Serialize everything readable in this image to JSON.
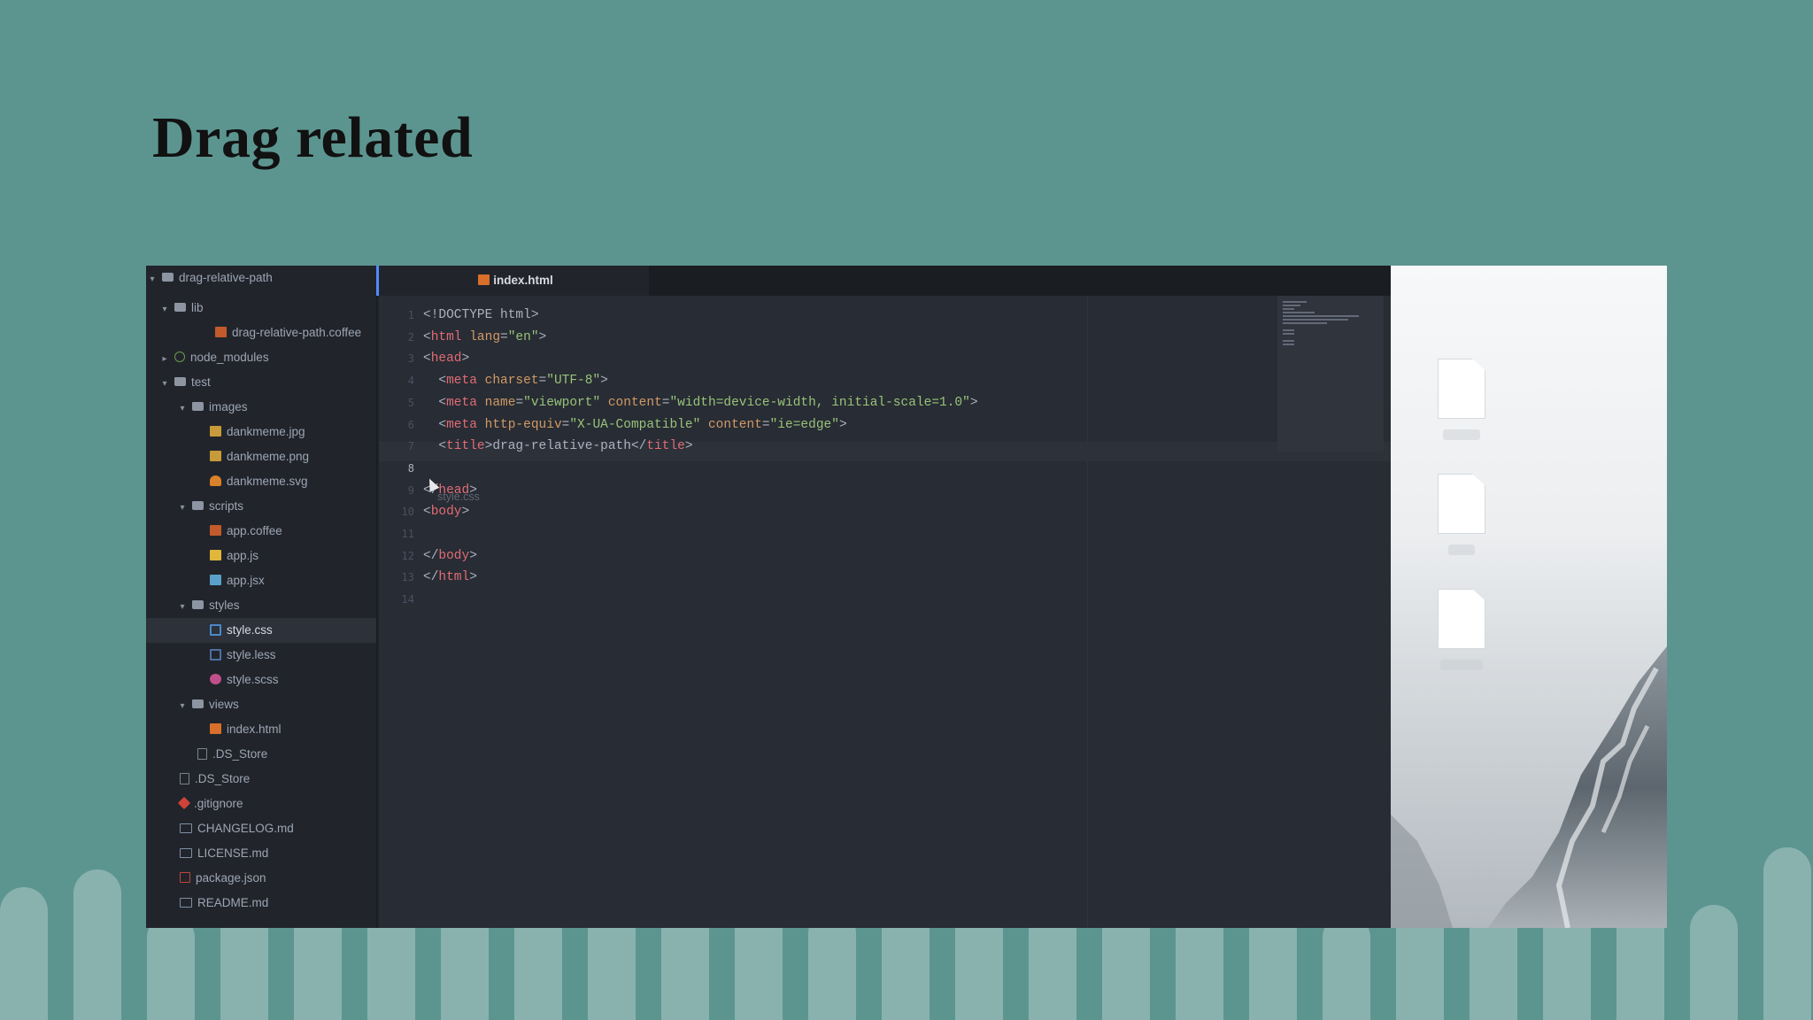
{
  "slide": {
    "title": "Drag related"
  },
  "tree": {
    "root": "drag-relative-path",
    "rows": [
      {
        "label": "lib",
        "arrow": "▾",
        "icon": "folder"
      },
      {
        "label": "drag-relative-path.coffee",
        "arrow": "",
        "icon": "coffee"
      },
      {
        "label": "node_modules",
        "arrow": "▸",
        "icon": "modules"
      },
      {
        "label": "test",
        "arrow": "▾",
        "icon": "folder"
      },
      {
        "label": "images",
        "arrow": "▾",
        "icon": "folder"
      },
      {
        "label": "dankmeme.jpg",
        "arrow": "",
        "icon": "img"
      },
      {
        "label": "dankmeme.png",
        "arrow": "",
        "icon": "img"
      },
      {
        "label": "dankmeme.svg",
        "arrow": "",
        "icon": "svgi"
      },
      {
        "label": "scripts",
        "arrow": "▾",
        "icon": "folder"
      },
      {
        "label": "app.coffee",
        "arrow": "",
        "icon": "coffee"
      },
      {
        "label": "app.js",
        "arrow": "",
        "icon": "js"
      },
      {
        "label": "app.jsx",
        "arrow": "",
        "icon": "jsx"
      },
      {
        "label": "styles",
        "arrow": "▾",
        "icon": "folder"
      },
      {
        "label": "style.css",
        "arrow": "",
        "icon": "css",
        "selected": true
      },
      {
        "label": "style.less",
        "arrow": "",
        "icon": "less"
      },
      {
        "label": "style.scss",
        "arrow": "",
        "icon": "scss"
      },
      {
        "label": "views",
        "arrow": "▾",
        "icon": "folder"
      },
      {
        "label": "index.html",
        "arrow": "",
        "icon": "html"
      },
      {
        "label": ".DS_Store",
        "arrow": "",
        "icon": "doc"
      },
      {
        "label": ".DS_Store",
        "arrow": "",
        "icon": "doc"
      },
      {
        "label": ".gitignore",
        "arrow": "",
        "icon": "git"
      },
      {
        "label": "CHANGELOG.md",
        "arrow": "",
        "icon": "md"
      },
      {
        "label": "LICENSE.md",
        "arrow": "",
        "icon": "md"
      },
      {
        "label": "package.json",
        "arrow": "",
        "icon": "json"
      },
      {
        "label": "README.md",
        "arrow": "",
        "icon": "md"
      }
    ]
  },
  "editor": {
    "tab_label": "index.html",
    "current_line": "8",
    "drag_ghost": "style.css",
    "lines": [
      [
        [
          "p",
          "<!DOCTYPE html>"
        ]
      ],
      [
        [
          "p",
          "<"
        ],
        [
          "t",
          "html"
        ],
        [
          "p",
          " "
        ],
        [
          "a",
          "lang"
        ],
        [
          "p",
          "="
        ],
        [
          "s",
          "\"en\""
        ],
        [
          "p",
          ">"
        ]
      ],
      [
        [
          "p",
          "<"
        ],
        [
          "t",
          "head"
        ],
        [
          "p",
          ">"
        ]
      ],
      [
        [
          "p",
          "  <"
        ],
        [
          "t",
          "meta"
        ],
        [
          "p",
          " "
        ],
        [
          "a",
          "charset"
        ],
        [
          "p",
          "="
        ],
        [
          "s",
          "\"UTF-8\""
        ],
        [
          "p",
          ">"
        ]
      ],
      [
        [
          "p",
          "  <"
        ],
        [
          "t",
          "meta"
        ],
        [
          "p",
          " "
        ],
        [
          "a",
          "name"
        ],
        [
          "p",
          "="
        ],
        [
          "s",
          "\"viewport\""
        ],
        [
          "p",
          " "
        ],
        [
          "a",
          "content"
        ],
        [
          "p",
          "="
        ],
        [
          "s",
          "\"width=device-width, initial-scale=1.0\""
        ],
        [
          "p",
          ">"
        ]
      ],
      [
        [
          "p",
          "  <"
        ],
        [
          "t",
          "meta"
        ],
        [
          "p",
          " "
        ],
        [
          "a",
          "http-equiv"
        ],
        [
          "p",
          "="
        ],
        [
          "s",
          "\"X-UA-Compatible\""
        ],
        [
          "p",
          " "
        ],
        [
          "a",
          "content"
        ],
        [
          "p",
          "="
        ],
        [
          "s",
          "\"ie=edge\""
        ],
        [
          "p",
          ">"
        ]
      ],
      [
        [
          "p",
          "  <"
        ],
        [
          "t",
          "title"
        ],
        [
          "p",
          ">drag-relative-path</"
        ],
        [
          "t",
          "title"
        ],
        [
          "p",
          ">"
        ]
      ],
      [],
      [
        [
          "p",
          "</"
        ],
        [
          "t",
          "head"
        ],
        [
          "p",
          ">"
        ]
      ],
      [
        [
          "p",
          "<"
        ],
        [
          "t",
          "body"
        ],
        [
          "p",
          ">"
        ]
      ],
      [],
      [
        [
          "p",
          "</"
        ],
        [
          "t",
          "body"
        ],
        [
          "p",
          ">"
        ]
      ],
      [
        [
          "p",
          "</"
        ],
        [
          "t",
          "html"
        ],
        [
          "p",
          ">"
        ]
      ],
      []
    ]
  }
}
